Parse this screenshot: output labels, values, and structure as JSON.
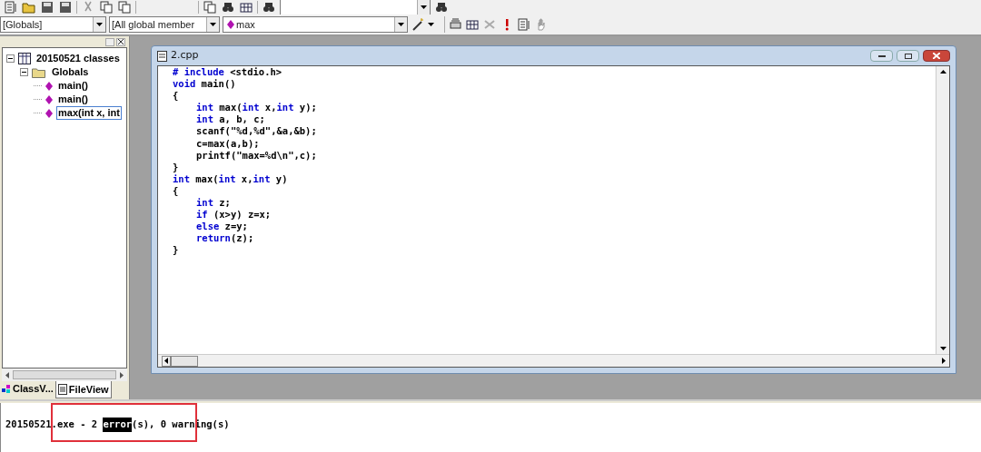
{
  "toolbar": {
    "combos": [
      {
        "text": "[Globals]"
      },
      {
        "text": "[All global member"
      },
      {
        "text": "max"
      }
    ]
  },
  "class_tree": {
    "items": [
      {
        "label": "20150521 classes",
        "kind": "project",
        "expanded": true,
        "selected": false,
        "children": [
          {
            "label": "Globals",
            "kind": "folder",
            "expanded": true,
            "selected": false,
            "children": [
              {
                "label": "main()",
                "kind": "function",
                "selected": false
              },
              {
                "label": "main()",
                "kind": "function",
                "selected": false
              },
              {
                "label": "max(int x, int",
                "kind": "function",
                "selected": true
              }
            ]
          }
        ]
      }
    ]
  },
  "workspace_tabs": [
    {
      "label": "ClassV...",
      "kind": "class",
      "selected": false
    },
    {
      "label": "FileView",
      "kind": "file",
      "selected": true
    }
  ],
  "editor": {
    "title": "2.cpp",
    "lines": [
      {
        "tokens": [
          {
            "text": "# include",
            "keyword": true
          },
          {
            "text": " <stdio.h>",
            "keyword": false
          }
        ]
      },
      {
        "tokens": [
          {
            "text": "void",
            "keyword": true
          },
          {
            "text": " main()",
            "keyword": false
          }
        ]
      },
      {
        "tokens": [
          {
            "text": "{",
            "keyword": false
          }
        ],
        "children": [
          {
            "tokens": [
              {
                "text": "int",
                "keyword": true
              },
              {
                "text": " max(",
                "keyword": false
              },
              {
                "text": "int",
                "keyword": true
              },
              {
                "text": " x,",
                "keyword": false
              },
              {
                "text": "int",
                "keyword": true
              },
              {
                "text": " y);",
                "keyword": false
              }
            ]
          },
          {
            "tokens": [
              {
                "text": "int",
                "keyword": true
              },
              {
                "text": " a, b, c;",
                "keyword": false
              }
            ]
          },
          {
            "tokens": [
              {
                "text": "scanf(\"%d,%d\",&a,&b);",
                "keyword": false
              }
            ]
          },
          {
            "tokens": [
              {
                "text": "c=max(a,b);",
                "keyword": false
              }
            ]
          },
          {
            "tokens": [
              {
                "text": "printf(\"max=%d\\n\",c);",
                "keyword": false
              }
            ]
          }
        ]
      },
      {
        "tokens": [
          {
            "text": "}",
            "keyword": false
          }
        ]
      },
      {
        "tokens": [
          {
            "text": "int",
            "keyword": true
          },
          {
            "text": " max(",
            "keyword": false
          },
          {
            "text": "int",
            "keyword": true
          },
          {
            "text": " x,",
            "keyword": false
          },
          {
            "text": "int",
            "keyword": true
          },
          {
            "text": " y)",
            "keyword": false
          }
        ]
      },
      {
        "tokens": [
          {
            "text": "{",
            "keyword": false
          }
        ],
        "children": [
          {
            "tokens": [
              {
                "text": "int",
                "keyword": true
              },
              {
                "text": " z;",
                "keyword": false
              }
            ]
          },
          {
            "tokens": [
              {
                "text": "if",
                "keyword": true
              },
              {
                "text": " (x>y) z=x;",
                "keyword": false
              }
            ]
          },
          {
            "tokens": [
              {
                "text": "else",
                "keyword": true
              },
              {
                "text": " z=y;",
                "keyword": false
              }
            ]
          },
          {
            "tokens": [
              {
                "text": "return",
                "keyword": true
              },
              {
                "text": "(z);",
                "keyword": false
              }
            ]
          }
        ]
      },
      {
        "tokens": [
          {
            "text": "}",
            "keyword": false
          }
        ]
      }
    ]
  },
  "output": {
    "segments": [
      {
        "text": "20150521.exe - 2 ",
        "highlighted": false
      },
      {
        "text": "error",
        "highlighted": true
      },
      {
        "text": "(s), 0 warning(s)",
        "highlighted": false
      }
    ]
  }
}
